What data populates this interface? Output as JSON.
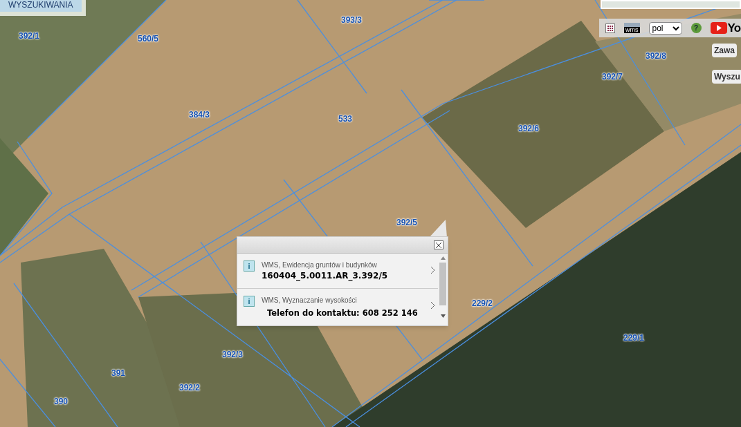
{
  "top_left_button": {
    "label": "WYSZUKIWANIA"
  },
  "parcel_labels": [
    "392/1",
    "560/5",
    "393/3",
    "384/3",
    "533",
    "392/6",
    "392/7",
    "392/8",
    "392/5",
    "229/2",
    "229/1",
    "392/3",
    "391",
    "392/2",
    "390"
  ],
  "toolbar": {
    "wms_label": "wms",
    "language": "pol",
    "help_glyph": "?",
    "youtube_text": "Yo"
  },
  "side_buttons": [
    "Zawa",
    "Wyszu"
  ],
  "popup": {
    "items": [
      {
        "info_glyph": "i",
        "source": "WMS, Ewidencja gruntów i budynków",
        "value": "160404_5.0011.AR_3.392/5",
        "kind": "mono"
      },
      {
        "info_glyph": "i",
        "source": "WMS, Wyznaczanie wysokości",
        "value": "Telefon do kontaktu: 608 252 146",
        "kind": "sans"
      }
    ]
  }
}
